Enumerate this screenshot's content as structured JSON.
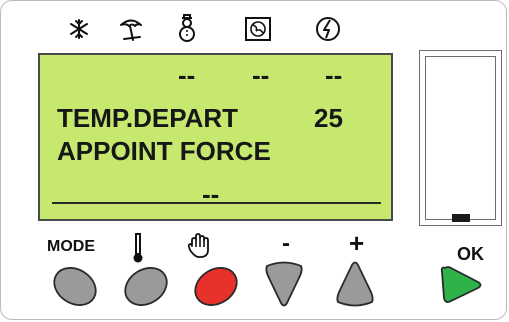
{
  "top_icons": [
    {
      "name": "snowflake-icon"
    },
    {
      "name": "umbrella-icon"
    },
    {
      "name": "snowman-icon"
    },
    {
      "name": "fan-icon"
    },
    {
      "name": "lightning-icon"
    }
  ],
  "lcd": {
    "top_dashes": [
      "--",
      "--",
      "--"
    ],
    "line1_label": "TEMP.DEPART",
    "line1_value": "25",
    "line2_label": "APPOINT FORCE",
    "bottom_dashes": "--"
  },
  "controls": {
    "mode_label": "MODE",
    "minus_label": "-",
    "plus_label": "+",
    "ok_label": "OK"
  },
  "colors": {
    "lcd_green": "#c6e86f",
    "button_gray": "#9a9a9a",
    "hand_button_red": "#e8312a",
    "ok_button_green": "#2db34a"
  }
}
